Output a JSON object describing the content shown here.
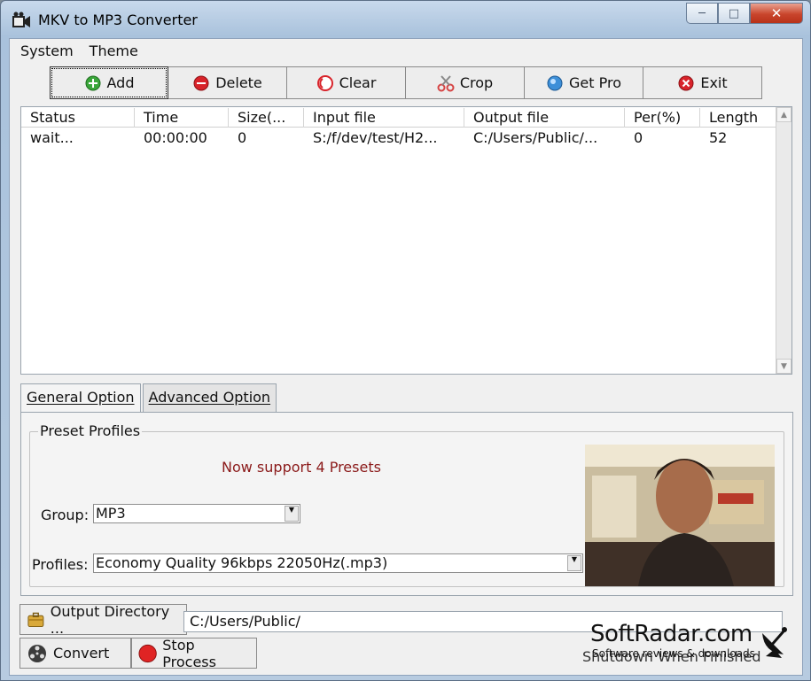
{
  "window": {
    "title": "MKV to MP3 Converter"
  },
  "menu": [
    {
      "label": "System"
    },
    {
      "label": "Theme"
    }
  ],
  "toolbar": [
    {
      "label": "Add",
      "icon": "add-icon",
      "color": "#3aa63a"
    },
    {
      "label": "Delete",
      "icon": "delete-icon",
      "color": "#d8232a"
    },
    {
      "label": "Clear",
      "icon": "clear-icon",
      "color": "#d8232a"
    },
    {
      "label": "Crop",
      "icon": "scissors-icon",
      "color": "#d64545"
    },
    {
      "label": "Get Pro",
      "icon": "get-pro-icon",
      "color": "#3d8fd8"
    },
    {
      "label": "Exit",
      "icon": "exit-icon",
      "color": "#d8232a"
    }
  ],
  "file_list": {
    "columns": [
      "Status",
      "Time",
      "Size(...",
      "Input file",
      "Output file",
      "Per(%)",
      "Length"
    ],
    "rows": [
      [
        "wait...",
        "00:00:00",
        "0",
        "S:/f/dev/test/H2...",
        "C:/Users/Public/...",
        "0",
        "52"
      ]
    ]
  },
  "tabs": [
    {
      "label": "General Option"
    },
    {
      "label": "Advanced Option"
    }
  ],
  "preset": {
    "group_title": "Preset Profiles",
    "support_text": "Now support 4 Presets",
    "group_label": "Group:",
    "group_value": "MP3",
    "profiles_label": "Profiles:",
    "profiles_value": "Economy Quality 96kbps 22050Hz(.mp3)"
  },
  "bottom": {
    "output_dir_label": "Output Directory ...",
    "output_dir_value": "C:/Users/Public/",
    "convert_label": "Convert",
    "stop_label": "Stop Process",
    "shutdown_label": "Shutdown When Finished"
  },
  "watermark": {
    "title": "SoftRadar.com",
    "subtitle": "Software reviews & downloads"
  }
}
